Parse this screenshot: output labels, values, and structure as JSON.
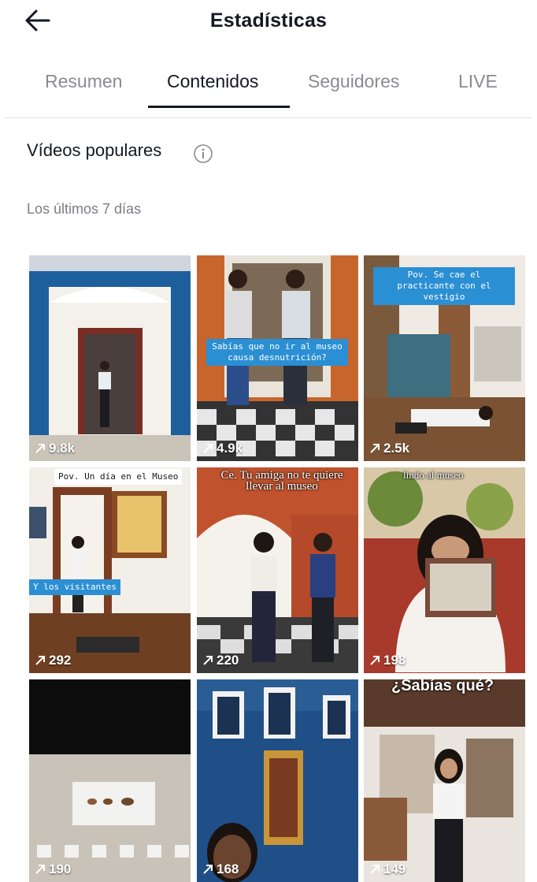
{
  "header": {
    "title": "Estadísticas"
  },
  "tabs": [
    {
      "label": "Resumen",
      "active": false
    },
    {
      "label": "Contenidos",
      "active": true
    },
    {
      "label": "Seguidores",
      "active": false
    },
    {
      "label": "LIVE",
      "active": false
    }
  ],
  "section": {
    "title": "Vídeos populares",
    "subtitle": "Los últimos 7 días"
  },
  "videos": [
    {
      "views": "9.8k",
      "caption": ""
    },
    {
      "views": "4.9k",
      "caption": "Sabías que no ir al museo causa desnutrición?"
    },
    {
      "views": "2.5k",
      "caption": "Pov. Se cae el practicante con el vestigio"
    },
    {
      "views": "292",
      "caption_top": "Pov. Un día en el Museo",
      "caption": "Y los visitantes"
    },
    {
      "views": "220",
      "caption": "Ce. Tu amiga no te quiere llevar al museo"
    },
    {
      "views": "198",
      "caption": "lindo al museo"
    },
    {
      "views": "190",
      "caption": ""
    },
    {
      "views": "168",
      "caption": ""
    },
    {
      "views": "149",
      "caption": "¿Sabías qué?"
    }
  ],
  "icons": {
    "back": "arrow-left-icon",
    "info": "info-circle-icon",
    "views": "arrow-up-right-icon"
  },
  "colors": {
    "text": "#161823",
    "muted": "#8a8b91",
    "caption_blue": "#2b8fd4"
  }
}
